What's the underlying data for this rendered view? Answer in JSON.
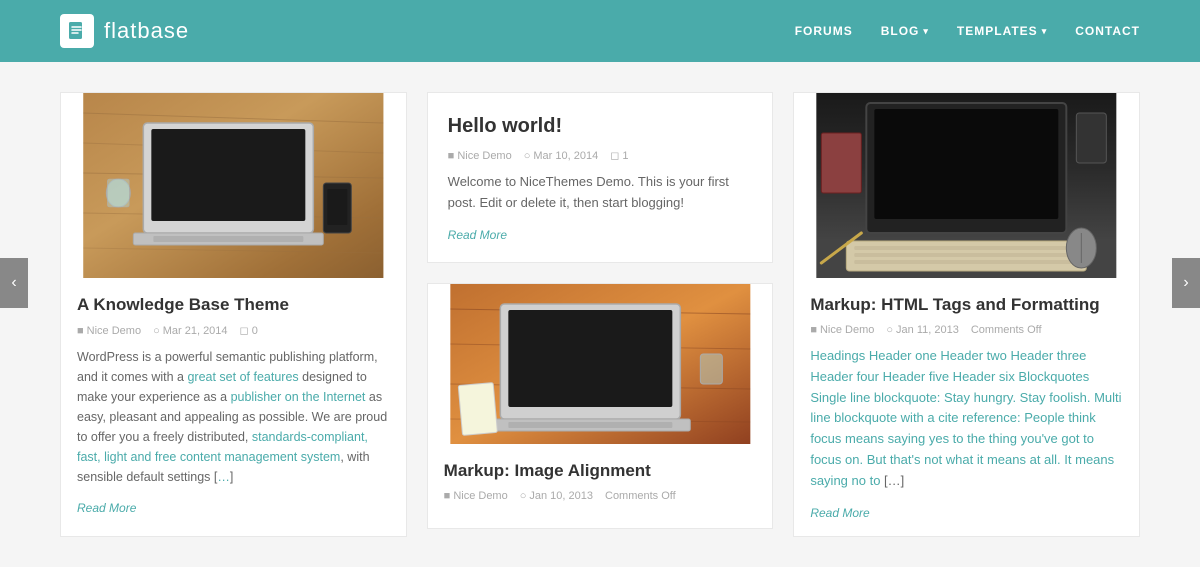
{
  "header": {
    "logo_text": "flatbase",
    "logo_icon": "📄",
    "nav": [
      {
        "label": "FORUMS",
        "has_dropdown": false
      },
      {
        "label": "BLOG",
        "has_dropdown": true
      },
      {
        "label": "TEMPLATES",
        "has_dropdown": true
      },
      {
        "label": "CONTACT",
        "has_dropdown": false
      }
    ]
  },
  "side_arrows": {
    "left": "‹",
    "right": "›"
  },
  "cards": [
    {
      "id": "card-1",
      "title": "A Knowledge Base Theme",
      "author": "Nice Demo",
      "date": "Mar 21, 2014",
      "comments": "0",
      "text": "WordPress is a powerful semantic publishing platform, and it comes with a great set of features designed to make your experience as a publisher on the Internet as easy, pleasant and appealing as possible. We are proud to offer you a freely distributed, standards-compliant, fast, light and free content management system, with sensible default settings […]",
      "read_more": "Read More",
      "has_image": true,
      "image_type": "laptop-desk"
    },
    {
      "id": "card-2",
      "title": "Hello world!",
      "author": "Nice Demo",
      "date": "Mar 10, 2014",
      "comments": "1",
      "text": "Welcome to NiceThemes Demo. This is your first post. Edit or delete it, then start blogging!",
      "read_more": "Read More",
      "has_image": false,
      "image_type": null
    },
    {
      "id": "card-3",
      "title": "Markup: HTML Tags and Formatting",
      "author": "Nice Demo",
      "date": "Jan 11, 2013",
      "comments": "Comments Off",
      "text": "Headings Header one Header two Header three Header four Header five Header six Blockquotes Single line blockquote: Stay hungry. Stay foolish. Multi line blockquote with a cite reference: People think focus means saying yes to the thing you've got to focus on. But that's not what it means at all. It means saying no to […]",
      "read_more": "Read More",
      "has_image": true,
      "image_type": "desk-overhead"
    },
    {
      "id": "card-4",
      "title": "Markup: Image Alignment",
      "author": "Nice Demo",
      "date": "Jan 10, 2013",
      "comments": "Comments Off",
      "text": "",
      "read_more": "",
      "has_image": true,
      "image_type": "laptop-warm"
    }
  ],
  "icons": {
    "user": "👤",
    "clock": "🕐",
    "comment": "💬",
    "doc": "📄"
  },
  "colors": {
    "accent": "#4aabaa",
    "header_bg": "#4aabaa",
    "nav_text": "#ffffff",
    "body_bg": "#f5f5f5"
  }
}
